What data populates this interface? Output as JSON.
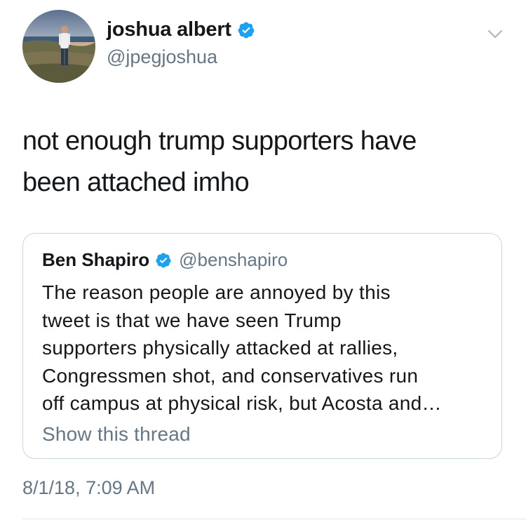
{
  "tweet": {
    "author": {
      "name": "joshua albert",
      "handle": "@jpegjoshua",
      "verified": true,
      "avatar_icon": "profile-photo"
    },
    "text": "not enough trump supporters have\nbeen attached imho",
    "timestamp": "8/1/18, 7:09 AM",
    "menu_icon": "chevron-down-icon"
  },
  "quoted_tweet": {
    "author": {
      "name": "Ben Shapiro",
      "handle": "@benshapiro",
      "verified": true
    },
    "text": "The reason people are annoyed by this\ntweet is that we have seen Trump\nsupporters physically attacked at rallies,\nCongressmen shot, and conservatives run\noff campus at physical risk, but Acosta and…",
    "thread_link": "Show this thread"
  },
  "colors": {
    "text_primary": "#14171a",
    "text_secondary": "#657786",
    "verified_blue": "#1da1f2",
    "border": "#ccd6dd"
  }
}
